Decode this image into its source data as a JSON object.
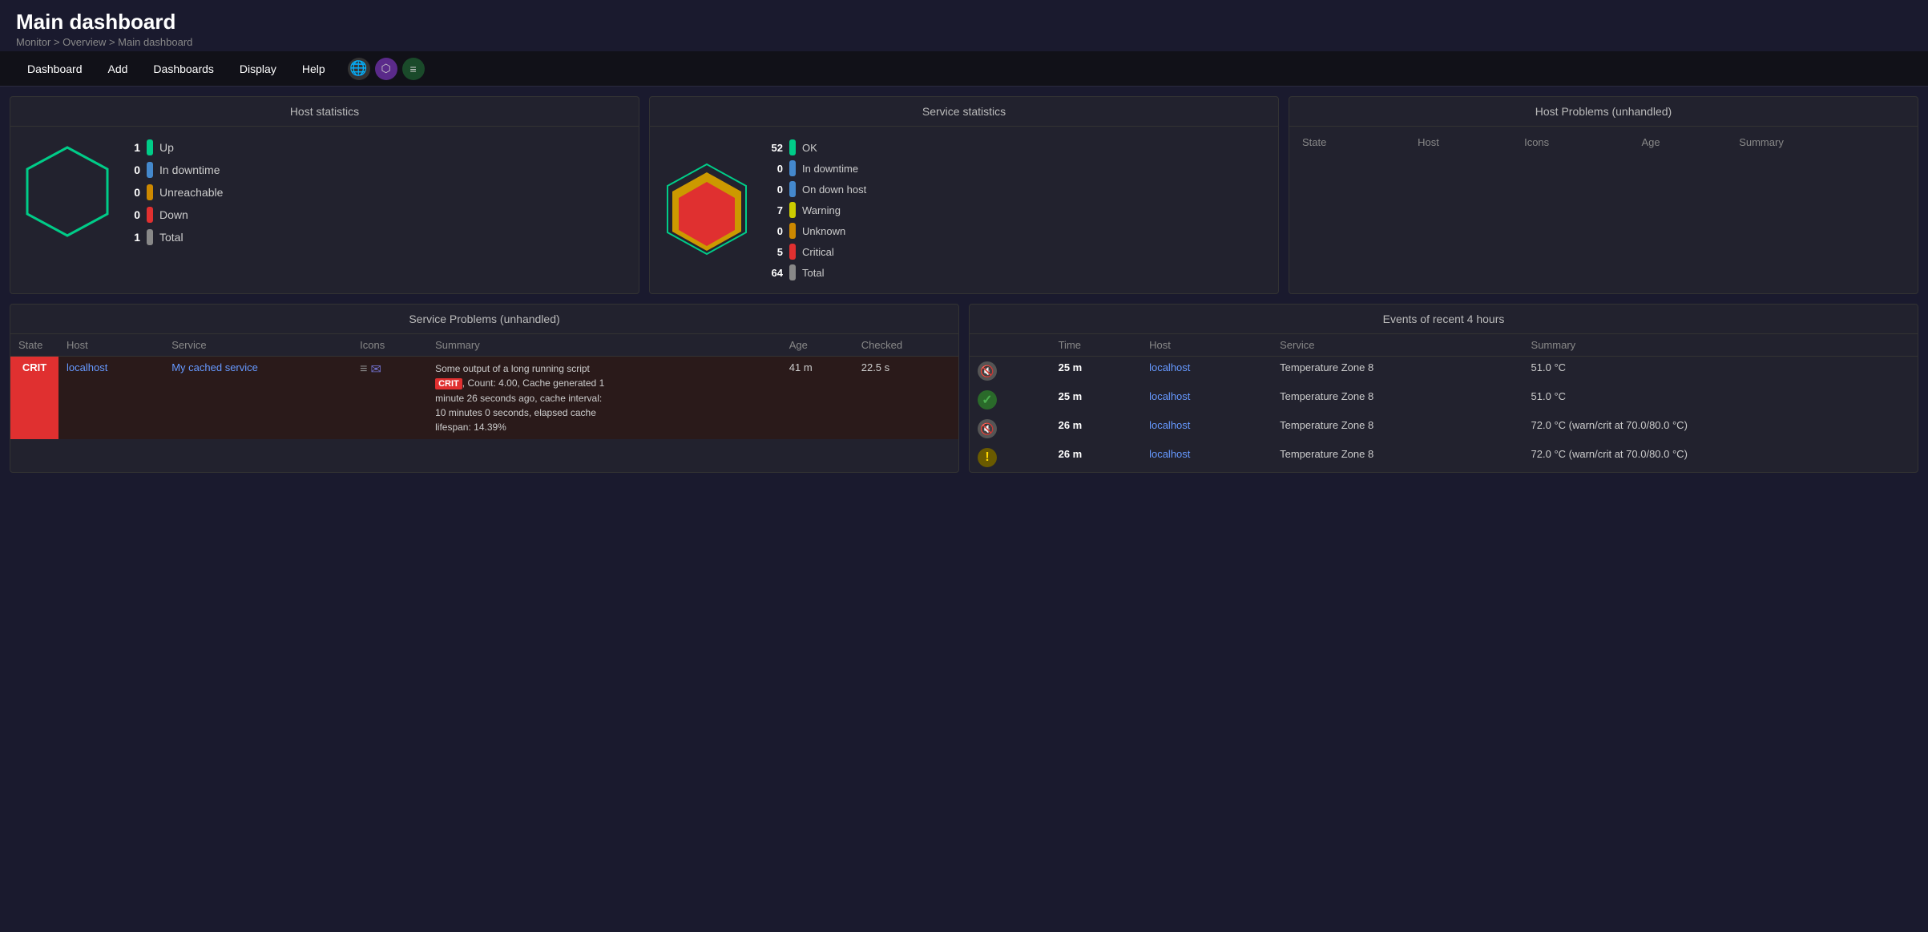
{
  "header": {
    "title": "Main dashboard",
    "breadcrumb": "Monitor > Overview > Main dashboard"
  },
  "nav": {
    "items": [
      "Dashboard",
      "Add",
      "Dashboards",
      "Display",
      "Help"
    ],
    "icons": [
      "🌐",
      "🟣",
      "🟢"
    ]
  },
  "host_statistics": {
    "title": "Host statistics",
    "stats": [
      {
        "value": "1",
        "label": "Up",
        "color": "#00cc88"
      },
      {
        "value": "0",
        "label": "In downtime",
        "color": "#4488cc"
      },
      {
        "value": "0",
        "label": "Unreachable",
        "color": "#cc8800"
      },
      {
        "value": "0",
        "label": "Down",
        "color": "#e03030"
      },
      {
        "value": "1",
        "label": "Total",
        "color": "#888"
      }
    ]
  },
  "service_statistics": {
    "title": "Service statistics",
    "stats": [
      {
        "value": "52",
        "label": "OK",
        "color": "#00cc88"
      },
      {
        "value": "0",
        "label": "In downtime",
        "color": "#4488cc"
      },
      {
        "value": "0",
        "label": "On down host",
        "color": "#4488cc"
      },
      {
        "value": "7",
        "label": "Warning",
        "color": "#cccc00"
      },
      {
        "value": "0",
        "label": "Unknown",
        "color": "#cc8800"
      },
      {
        "value": "5",
        "label": "Critical",
        "color": "#e03030"
      },
      {
        "value": "64",
        "label": "Total",
        "color": "#888"
      }
    ]
  },
  "host_problems": {
    "title": "Host Problems (unhandled)",
    "columns": [
      "State",
      "Host",
      "Icons",
      "Age",
      "Summary"
    ],
    "rows": []
  },
  "service_problems": {
    "title": "Service Problems (unhandled)",
    "columns": [
      "State",
      "Host",
      "Service",
      "Icons",
      "Summary",
      "Age",
      "Checked"
    ],
    "rows": [
      {
        "state": "CRIT",
        "host": "localhost",
        "service": "My cached service",
        "age": "41 m",
        "checked": "22.5 s",
        "summary": "Some output of a long running script CRIT, Count: 4.00, Cache generated 1 minute 26 seconds ago, cache interval: 10 minutes 0 seconds, elapsed cache lifespan: 14.39%"
      }
    ]
  },
  "events": {
    "title": "Events of recent 4 hours",
    "columns": [
      "",
      "Time",
      "Host",
      "Service",
      "Summary"
    ],
    "rows": [
      {
        "icon_type": "gray",
        "icon_symbol": "🔇",
        "time": "25 m",
        "host": "localhost",
        "service": "Temperature Zone 8",
        "summary": "51.0 °C"
      },
      {
        "icon_type": "green",
        "icon_symbol": "✓",
        "time": "25 m",
        "host": "localhost",
        "service": "Temperature Zone 8",
        "summary": "51.0 °C"
      },
      {
        "icon_type": "gray",
        "icon_symbol": "🔇",
        "time": "26 m",
        "host": "localhost",
        "service": "Temperature Zone 8",
        "summary": "72.0 °C (warn/crit at 70.0/80.0 °C)"
      },
      {
        "icon_type": "yellow",
        "icon_symbol": "!",
        "time": "26 m",
        "host": "localhost",
        "service": "Temperature Zone 8",
        "summary": "72.0 °C (warn/crit at 70.0/80.0 °C)"
      }
    ]
  }
}
